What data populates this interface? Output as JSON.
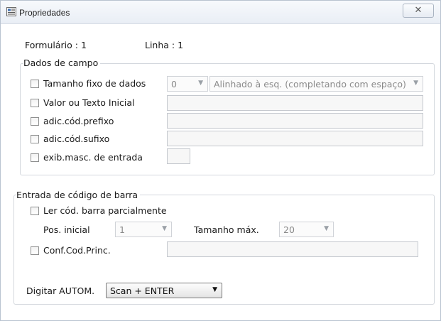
{
  "window": {
    "title": "Propriedades",
    "close_symbol": "✕"
  },
  "header": {
    "form_label": "Formulário : 1",
    "line_label": "Linha : 1"
  },
  "dados_de_campo": {
    "legend": "Dados de campo",
    "tamanho_fixo": {
      "label": "Tamanho fixo de dados",
      "checked": false,
      "size_value": "0",
      "align_value": "Alinhado à esq. (completando com espaço)"
    },
    "valor_inicial": {
      "label": "Valor ou Texto Inicial",
      "checked": false,
      "value": ""
    },
    "prefixo": {
      "label": "adic.cód.prefixo",
      "checked": false,
      "value": ""
    },
    "sufixo": {
      "label": "adic.cód.sufixo",
      "checked": false,
      "value": ""
    },
    "mascara": {
      "label": "exib.masc. de entrada",
      "checked": false,
      "value": ""
    }
  },
  "codigo_barra": {
    "legend": "Entrada de código de barra",
    "ler_parcial": {
      "label": "Ler cód. barra parcialmente",
      "checked": false
    },
    "pos_inicial": {
      "label": "Pos. inicial",
      "value": "1"
    },
    "tamanho_max": {
      "label": "Tamanho máx.",
      "value": "20"
    },
    "conf_cod_princ": {
      "label": "Conf.Cod.Princ.",
      "checked": false,
      "value": ""
    },
    "digitar_autom": {
      "label": "Digitar AUTOM.",
      "value": "Scan + ENTER"
    }
  },
  "icons": {
    "app": "properties-window-icon",
    "dropdown": "chevron-down-icon"
  }
}
